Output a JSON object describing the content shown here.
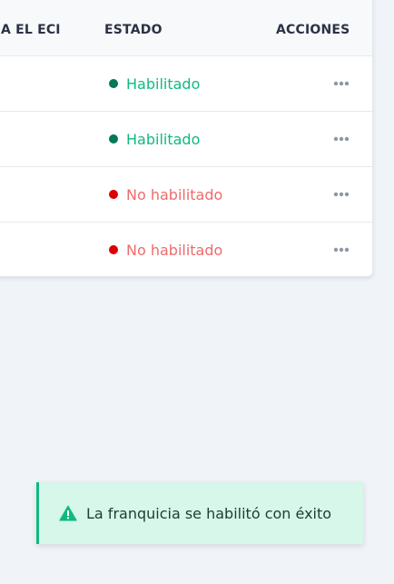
{
  "table": {
    "headers": {
      "eci": "A EL ECI",
      "estado": "ESTADO",
      "acciones": "ACCIONES"
    },
    "rows": [
      {
        "status": "Habilitado",
        "status_color": "#10b981",
        "dot_color": "#047857"
      },
      {
        "status": "Habilitado",
        "status_color": "#10b981",
        "dot_color": "#047857"
      },
      {
        "status": "No habilitado",
        "status_color": "#ef6b6b",
        "dot_color": "#dc0000"
      },
      {
        "status": "No habilitado",
        "status_color": "#ef6b6b",
        "dot_color": "#dc0000"
      }
    ],
    "actions_icon": "more-horizontal-icon"
  },
  "toast": {
    "message": "La franquicia se habilitó con éxito",
    "icon": "warning-triangle-icon",
    "accent": "#10b981",
    "background": "#d6f7e9"
  }
}
